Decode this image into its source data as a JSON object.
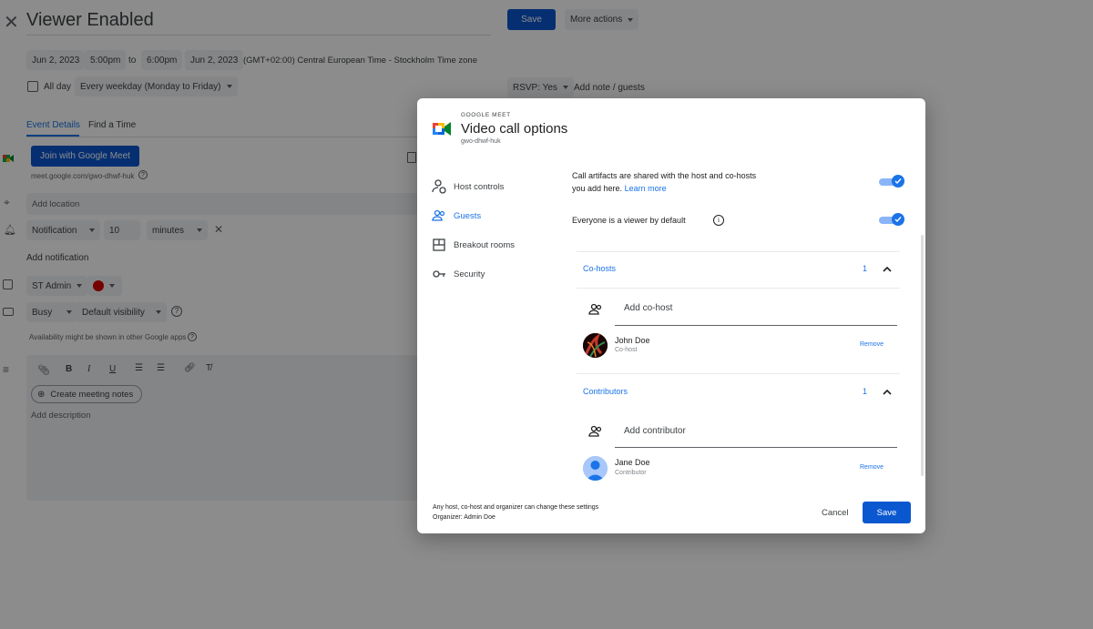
{
  "header": {
    "title": "Viewer Enabled",
    "save_label": "Save",
    "more_actions_label": "More actions"
  },
  "datetime": {
    "start_date": "Jun 2, 2023",
    "start_time": "5:00pm",
    "to_label": "to",
    "end_time": "6:00pm",
    "end_date": "Jun 2, 2023",
    "timezone_text": "(GMT+02:00) Central European Time - Stockholm",
    "timezone_link": "Time zone"
  },
  "recurrence": {
    "all_day_label": "All day",
    "repeat_value": "Every weekday (Monday to Friday)"
  },
  "rsvp": {
    "value": "RSVP: Yes",
    "add_note_label": "Add note / guests"
  },
  "tabs": [
    {
      "label": "Event Details"
    },
    {
      "label": "Find a Time"
    }
  ],
  "meet": {
    "join_label": "Join with Google Meet",
    "link": "meet.google.com/gwo-dhwf-huk"
  },
  "location": {
    "placeholder": "Add location"
  },
  "notification": {
    "type": "Notification",
    "amount": "10",
    "unit": "minutes",
    "add_label": "Add notification"
  },
  "calendar": {
    "owner": "ST Admin",
    "color": "#d50000"
  },
  "availability": {
    "status": "Busy",
    "visibility": "Default visibility",
    "note": "Availability might be shown in other Google apps"
  },
  "description": {
    "toolbar": [
      "B",
      "I",
      "U"
    ],
    "create_notes_label": "Create meeting notes",
    "placeholder": "Add description"
  },
  "dialog": {
    "brand": "GOOGLE MEET",
    "title": "Video call options",
    "code": "gwo-dhwf-huk",
    "nav": [
      {
        "label": "Host controls",
        "icon": "host-controls-icon"
      },
      {
        "label": "Guests",
        "icon": "guests-icon"
      },
      {
        "label": "Breakout rooms",
        "icon": "breakout-rooms-icon"
      },
      {
        "label": "Security",
        "icon": "security-icon"
      }
    ],
    "artifacts_text_1": "Call artifacts are shared with the host and co-hosts",
    "artifacts_text_2": "you add here.",
    "learn_more": "Learn more",
    "viewer_default_text": "Everyone is a viewer by default",
    "cohosts": {
      "heading": "Co-hosts",
      "count": "1",
      "add_placeholder": "Add co-host",
      "people": [
        {
          "name": "John Doe",
          "role": "Co-host",
          "remove": "Remove"
        }
      ]
    },
    "contributors": {
      "heading": "Contributors",
      "count": "1",
      "add_placeholder": "Add contributor",
      "people": [
        {
          "name": "Jane Doe",
          "role": "Contributor",
          "remove": "Remove"
        }
      ]
    },
    "footer_text_1": "Any host, co-host and organizer can change these settings",
    "footer_text_2": "Organizer: Admin Doe",
    "cancel_label": "Cancel",
    "save_label": "Save"
  },
  "colors": {
    "accent": "#1a73e8",
    "primary_button": "#0b57d0"
  }
}
